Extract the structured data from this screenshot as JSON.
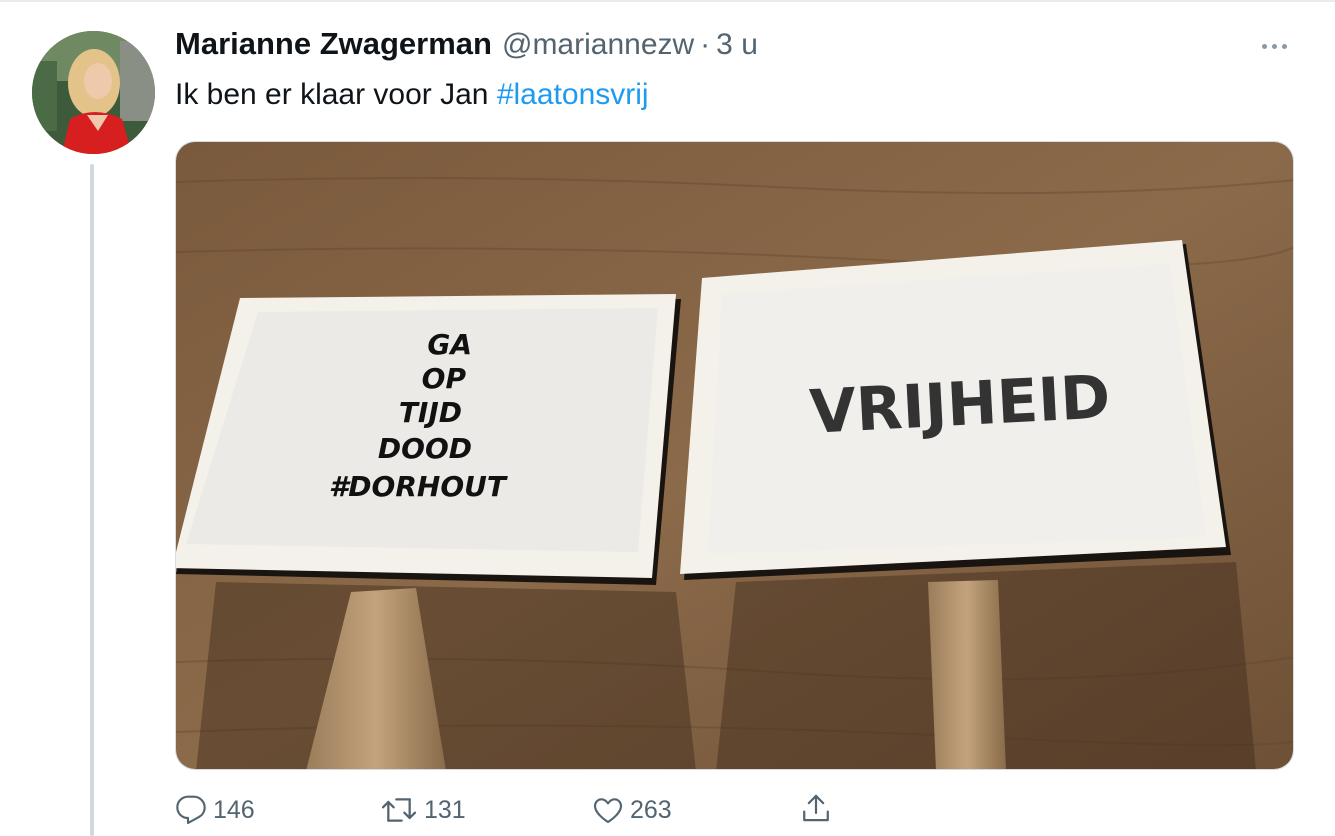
{
  "tweet": {
    "author_name": "Marianne Zwagerman",
    "author_handle": "@mariannezw",
    "separator": "·",
    "time_ago": "3 u",
    "text_prefix": "Ik ben er klaar voor Jan ",
    "hashtag": "#laatonsvrij"
  },
  "media": {
    "sign_left_lines": [
      "GA",
      "OP",
      "TIJD",
      "DOOD",
      "#DORHOUT"
    ],
    "sign_right_text": "VRIJHEID"
  },
  "actions": {
    "replies": "146",
    "retweets": "131",
    "likes": "263"
  },
  "colors": {
    "text": "#0f1419",
    "secondary": "#536471",
    "link": "#1d9bf0",
    "thread_line": "#cfd9de"
  },
  "icons": [
    "more-icon",
    "reply-icon",
    "retweet-icon",
    "like-icon",
    "share-icon"
  ]
}
